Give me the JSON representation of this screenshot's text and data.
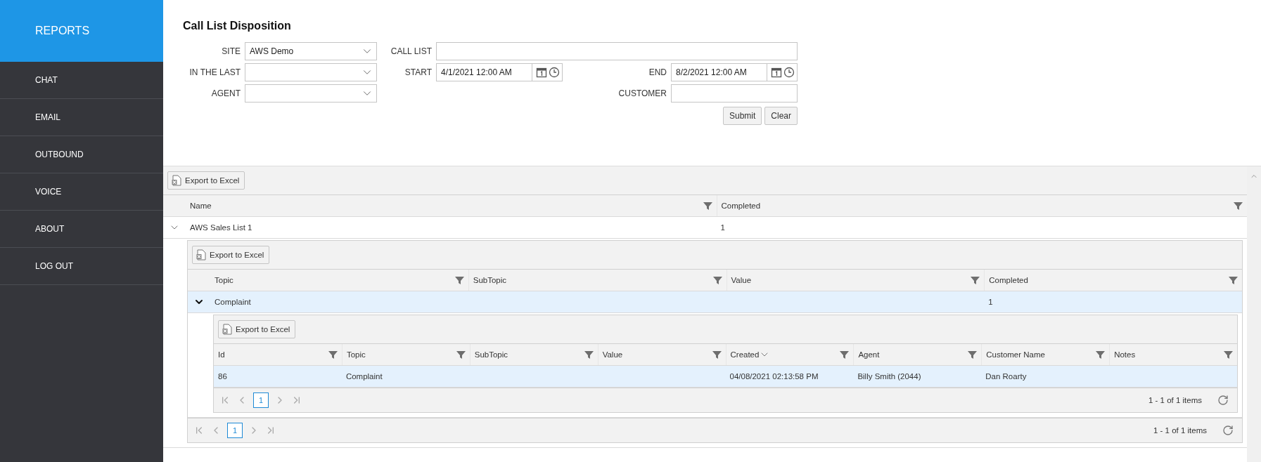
{
  "sidebar": {
    "header": "REPORTS",
    "items": [
      {
        "label": "CHAT"
      },
      {
        "label": "EMAIL"
      },
      {
        "label": "OUTBOUND"
      },
      {
        "label": "VOICE"
      },
      {
        "label": "ABOUT"
      },
      {
        "label": "LOG OUT"
      }
    ]
  },
  "title": "Call List Disposition",
  "form": {
    "site": {
      "label": "SITE",
      "kind": "select",
      "value": "AWS Demo"
    },
    "call_list": {
      "label": "CALL LIST",
      "kind": "text"
    },
    "in_the_last": {
      "label": "IN THE LAST",
      "kind": "select"
    },
    "start": {
      "label": "START",
      "kind": "datetime",
      "value": "4/1/2021 12:00 AM"
    },
    "end": {
      "label": "END",
      "kind": "datetime",
      "value": "8/2/2021 12:00 AM"
    },
    "agent": {
      "label": "AGENT",
      "kind": "select"
    },
    "customer": {
      "label": "CUSTOMER",
      "kind": "text"
    },
    "buttons": [
      "Submit",
      "Clear"
    ]
  },
  "grid": {
    "export": "Export to Excel",
    "columns": [
      {
        "label": "Name",
        "filter": true
      },
      {
        "label": "Completed",
        "filter": true
      }
    ],
    "rows": [
      {
        "expanded": true,
        "selected": false,
        "cells": [
          "AWS Sales List 1",
          "1"
        ],
        "detail": {
          "export": "Export to Excel",
          "columns": [
            {
              "label": "Topic",
              "filter": true
            },
            {
              "label": "SubTopic",
              "filter": true
            },
            {
              "label": "Value",
              "filter": true
            },
            {
              "label": "Completed",
              "filter": true
            }
          ],
          "rows": [
            {
              "expanded": true,
              "selected": true,
              "cells": [
                "Complaint",
                "",
                "",
                "1"
              ],
              "detail": {
                "export": "Export to Excel",
                "columns": [
                  {
                    "label": "Id",
                    "filter": true
                  },
                  {
                    "label": "Topic",
                    "filter": true
                  },
                  {
                    "label": "SubTopic",
                    "filter": true
                  },
                  {
                    "label": "Value",
                    "filter": true
                  },
                  {
                    "label": "Created",
                    "filter": true,
                    "sorted_descending": true
                  },
                  {
                    "label": "Agent",
                    "filter": true
                  },
                  {
                    "label": "Customer Name",
                    "filter": true
                  },
                  {
                    "label": "Notes",
                    "filter": true
                  }
                ],
                "rows": [
                  {
                    "selected": true,
                    "cells": [
                      "86",
                      "Complaint",
                      "",
                      "",
                      "04/08/2021 02:13:58 PM",
                      "Billy Smith (2044)",
                      "Dan Roarty",
                      ""
                    ]
                  }
                ],
                "pager": {
                  "pages": [
                    {
                      "label": "1",
                      "selected": true
                    }
                  ],
                  "summary": "1 - 1 of 1 items"
                }
              }
            }
          ],
          "pager": {
            "pages": [
              {
                "label": "1",
                "selected": true
              }
            ],
            "summary": "1 - 1 of 1 items"
          }
        }
      }
    ]
  }
}
